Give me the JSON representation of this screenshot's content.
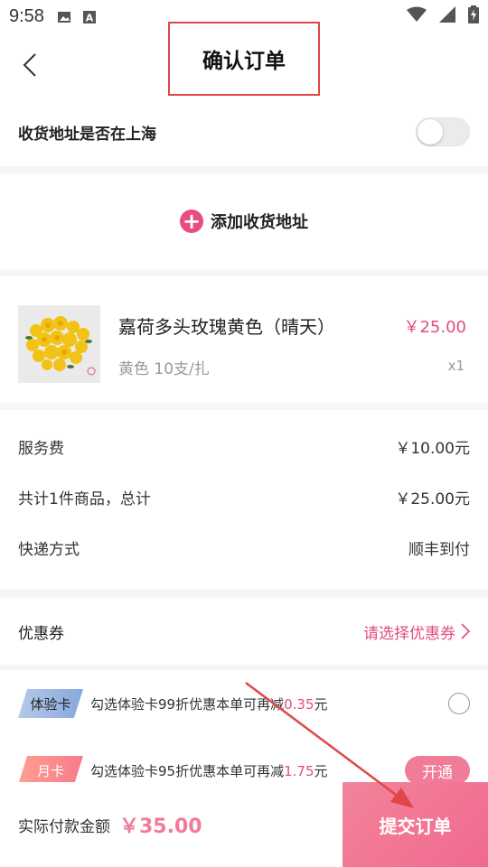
{
  "status_bar": {
    "time": "9:58",
    "icons": [
      "image-icon",
      "font-a-icon",
      "wifi-icon",
      "signal-icon",
      "battery-charging-icon"
    ]
  },
  "header": {
    "title": "确认订单",
    "back_icon": "chevron-left-icon"
  },
  "shanghai_row": {
    "label": "收货地址是否在上海",
    "toggle_on": false
  },
  "address": {
    "add_label": "添加收货地址",
    "add_icon": "plus-circle-icon"
  },
  "product": {
    "name": "嘉荷多头玫瑰黄色（晴天）",
    "price": "￥25.00",
    "spec": "黄色 10支/扎",
    "quantity": "x1",
    "image_icon": "yellow-roses-image"
  },
  "fees": [
    {
      "label": "服务费",
      "value": "￥10.00元"
    },
    {
      "label": "共计1件商品，总计",
      "value": "￥25.00元"
    },
    {
      "label": "快递方式",
      "value": "顺丰到付"
    }
  ],
  "coupon": {
    "label": "优惠券",
    "select_text": "请选择优惠券",
    "icon": "chevron-right-icon"
  },
  "trial_card": {
    "tag": "体验卡",
    "text_prefix": "勾选体验卡99折优惠本单可再减",
    "amount": "0.35",
    "unit": "元"
  },
  "monthly_card": {
    "tag": "月卡",
    "text_prefix": "勾选体验卡95折优惠本单可再减",
    "amount": "1.75",
    "unit": "元",
    "button": "开通"
  },
  "footer": {
    "pay_label": "实际付款金额",
    "pay_amount": "￥35.00",
    "submit_label": "提交订单"
  },
  "colors": {
    "accent": "#e04e7c",
    "submit_gradient_start": "#f3839a",
    "annotation_red": "#e04646"
  }
}
